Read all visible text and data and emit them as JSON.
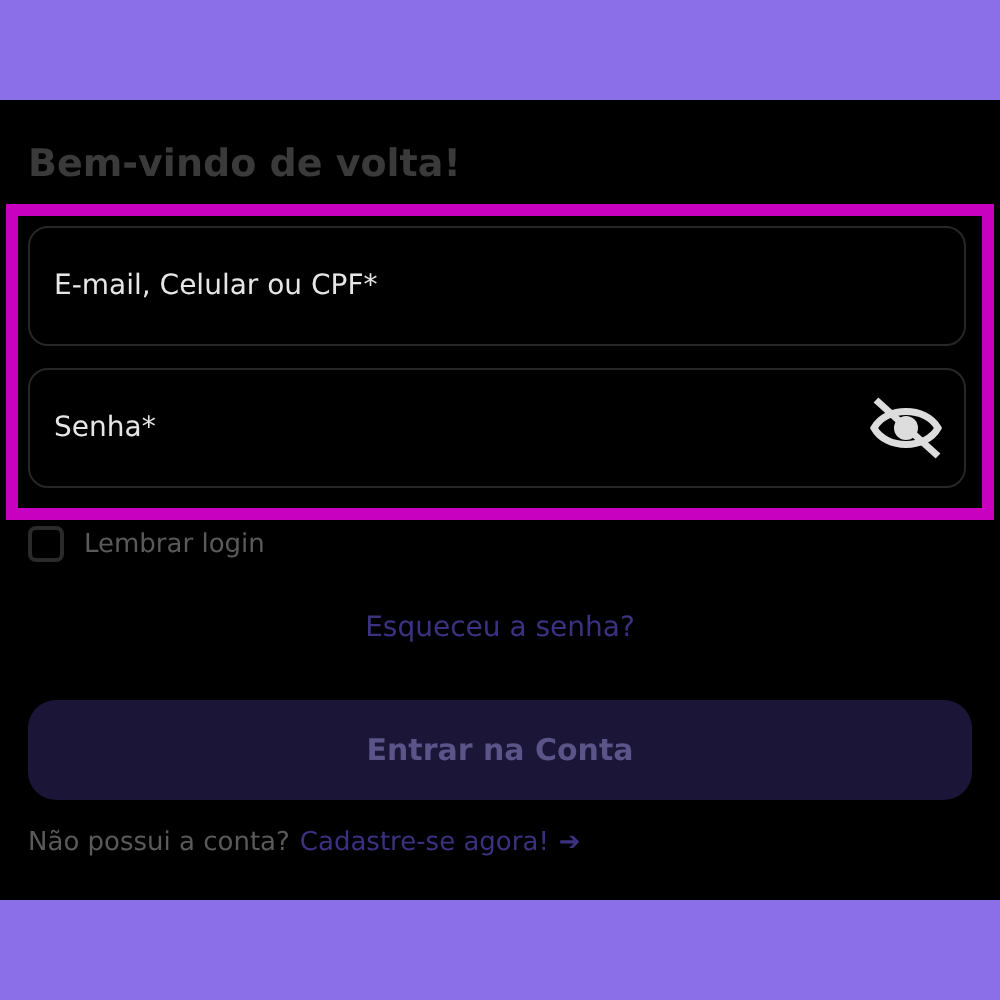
{
  "title": "Bem-vindo de volta!",
  "fields": [
    {
      "kind": "text",
      "placeholder": "E-mail, Celular ou CPF*"
    },
    {
      "kind": "password",
      "placeholder": "Senha*"
    }
  ],
  "remember": {
    "label": "Lembrar login",
    "checked": false
  },
  "forgot_link": "Esqueceu a senha?",
  "submit_button": "Entrar na Conta",
  "signup": {
    "text": "Não possui a conta?",
    "link": "Cadastre-se agora!",
    "arrow": "➔"
  }
}
